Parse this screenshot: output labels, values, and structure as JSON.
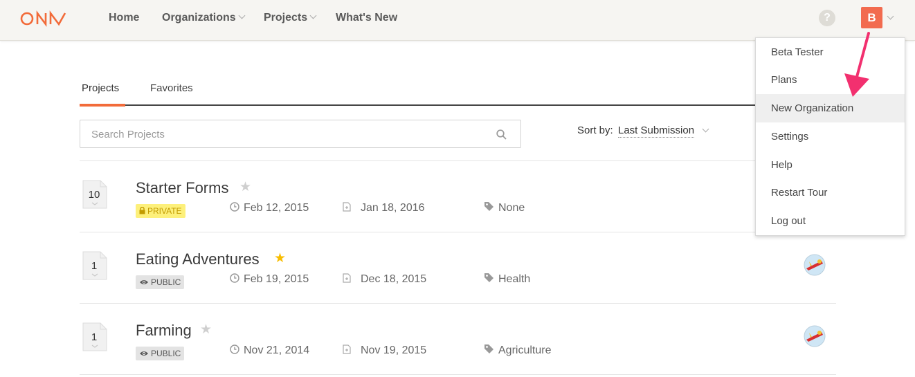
{
  "colors": {
    "accent": "#f26b3a",
    "avatar": "#f26b4f",
    "star_active": "#f8bd00",
    "arrow": "#f2306f"
  },
  "nav": {
    "logo_text": "ONA",
    "items": [
      {
        "label": "Home",
        "has_dropdown": false
      },
      {
        "label": "Organizations",
        "has_dropdown": true
      },
      {
        "label": "Projects",
        "has_dropdown": true
      },
      {
        "label": "What's New",
        "has_dropdown": false
      }
    ],
    "help_icon": "question-circle-icon",
    "avatar_initial": "B"
  },
  "tabs": [
    {
      "label": "Projects",
      "active": true
    },
    {
      "label": "Favorites",
      "active": false
    }
  ],
  "search": {
    "placeholder": "Search Projects",
    "value": ""
  },
  "sort": {
    "label": "Sort by:",
    "value": "Last Submission"
  },
  "projects": [
    {
      "count": "10",
      "title": "Starter Forms",
      "favorite": false,
      "visibility": "PRIVATE",
      "created": "Feb 12, 2015",
      "last_submission": "Jan 18, 2016",
      "tag": "None",
      "shared_avatar": false
    },
    {
      "count": "1",
      "title": "Eating Adventures",
      "favorite": true,
      "visibility": "PUBLIC",
      "created": "Feb 19, 2015",
      "last_submission": "Dec 18, 2015",
      "tag": "Health",
      "shared_avatar": true
    },
    {
      "count": "1",
      "title": "Farming",
      "favorite": false,
      "visibility": "PUBLIC",
      "created": "Nov 21, 2014",
      "last_submission": "Nov 19, 2015",
      "tag": "Agriculture",
      "shared_avatar": true
    }
  ],
  "user_menu": {
    "items": [
      {
        "label": "Beta Tester",
        "highlighted": false
      },
      {
        "label": "Plans",
        "highlighted": false
      },
      {
        "label": "New Organization",
        "highlighted": true
      },
      {
        "label": "Settings",
        "highlighted": false
      },
      {
        "label": "Help",
        "highlighted": false
      },
      {
        "label": "Restart Tour",
        "highlighted": false
      },
      {
        "label": "Log out",
        "highlighted": false
      }
    ]
  }
}
